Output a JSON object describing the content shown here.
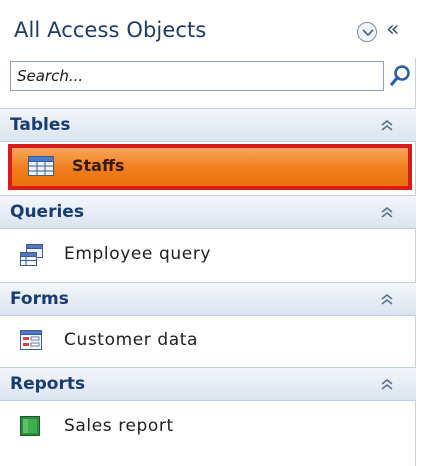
{
  "nav": {
    "title": "All Access Objects",
    "search_placeholder": "Search...",
    "groups": [
      {
        "label": "Tables",
        "items": [
          {
            "label": "Staffs",
            "selected": true,
            "icon": "table-icon"
          }
        ]
      },
      {
        "label": "Queries",
        "items": [
          {
            "label": "Employee query",
            "icon": "query-icon"
          }
        ]
      },
      {
        "label": "Forms",
        "items": [
          {
            "label": "Customer data",
            "icon": "form-icon"
          }
        ]
      },
      {
        "label": "Reports",
        "items": [
          {
            "label": "Sales report",
            "icon": "report-icon"
          }
        ]
      }
    ]
  },
  "colors": {
    "selection_fill": "#f07d1c",
    "selection_border": "#d41e1e",
    "group_label": "#173c73",
    "title": "#1c3d6b"
  }
}
